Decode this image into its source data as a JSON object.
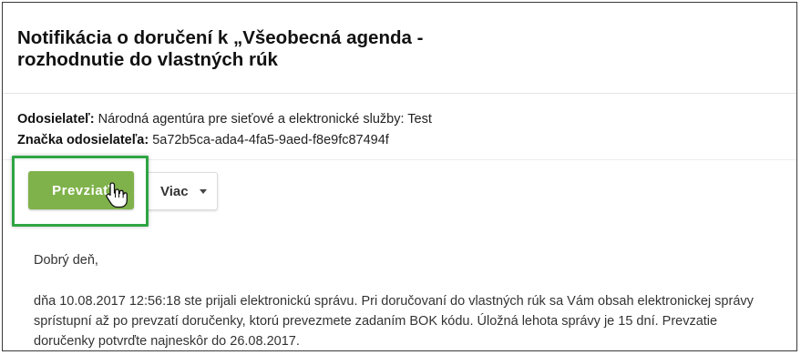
{
  "notification": {
    "title_line1": "Notifikácia o doručení k „Všeobecná agenda -",
    "title_line2": "rozhodnutie do vlastných rúk",
    "sender_label": "Odosielateľ:",
    "sender_value": "Národná agentúra pre sieťové a elektronické služby: Test",
    "ref_label": "Značka odosielateľa:",
    "ref_value": "5a72b5ca-ada4-4fa5-9aed-f8e9fc87494f"
  },
  "actions": {
    "primary_label": "Prevziať",
    "more_label": "Viac",
    "primary_color": "#7fb24a",
    "highlight_color": "#2fa544",
    "cursor_icon": "hand-pointer-icon"
  },
  "message": {
    "greeting": "Dobrý deň,",
    "line1": "dňa 10.08.2017 12:56:18 ste prijali elektronickú správu. Pri doručovaní do vlastných rúk sa Vám obsah elektronickej správy",
    "line2": "sprístupní až po prevzatí doručenky, ktorú prevezmete zadaním BOK kódu. Úložná lehota správy je 15 dní. Prevzatie",
    "line3": "doručenky potvrďte najneskôr do 26.08.2017."
  }
}
